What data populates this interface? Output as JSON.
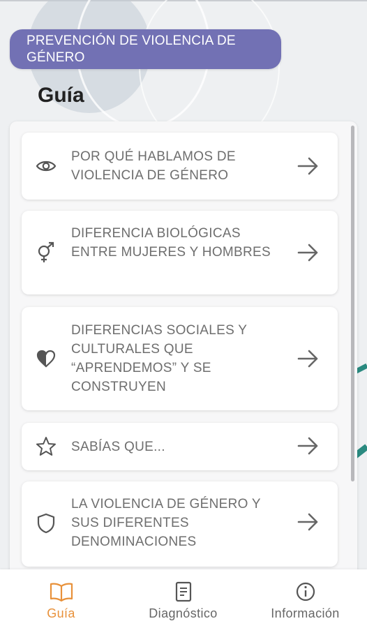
{
  "header": {
    "banner": "PREVENCIÓN DE VIOLENCIA DE GÉNERO"
  },
  "page": {
    "title": "Guía"
  },
  "colors": {
    "banner": "#7271b4",
    "accent_active": "#e8913a",
    "teal_deco": "#2a8a80"
  },
  "guide_items": [
    {
      "label": "POR QUÉ HABLAMOS DE VIOLENCIA DE GÉNERO",
      "icon": "eye-icon"
    },
    {
      "label": "DIFERENCIA BIOLÓGICAS ENTRE MUJERES Y HOMBRES",
      "icon": "gender-icon"
    },
    {
      "label": "DIFERENCIAS SOCIALES Y CULTURALES QUE “APRENDEMOS” Y SE CONSTRUYEN",
      "icon": "half-heart-icon"
    },
    {
      "label": "SABÍAS QUE...",
      "icon": "star-icon"
    },
    {
      "label": "LA VIOLENCIA DE GÉNERO Y SUS DIFERENTES DENOMINACIONES",
      "icon": "shield-icon"
    }
  ],
  "bottom_nav": [
    {
      "label": "Guía",
      "icon": "book-icon",
      "active": true
    },
    {
      "label": "Diagnóstico",
      "icon": "document-icon",
      "active": false
    },
    {
      "label": "Información",
      "icon": "info-icon",
      "active": false
    }
  ]
}
